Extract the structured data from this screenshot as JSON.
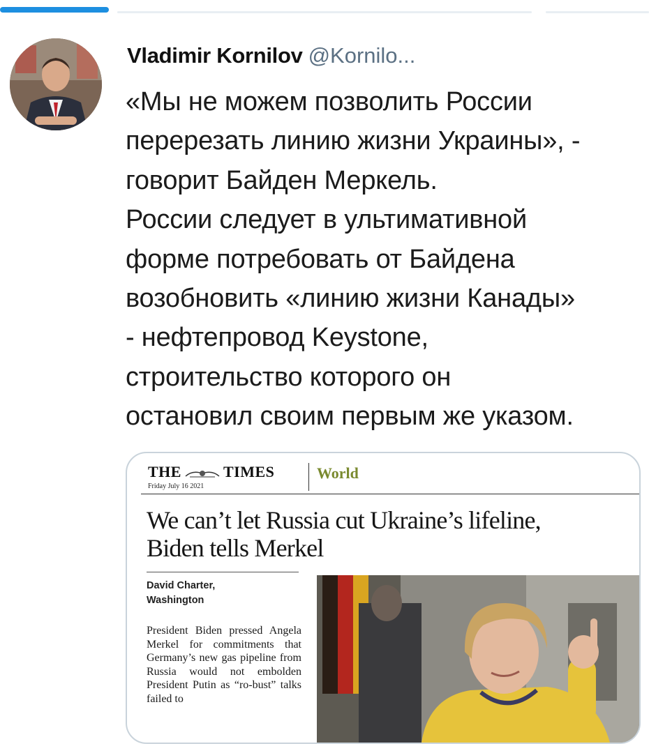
{
  "tweet": {
    "display_name": "Vladimir Kornilov",
    "handle": "@Kornilo...",
    "text_lines": [
      "«Мы не можем позволить России",
      "перерезать линию жизни Украины», -",
      "говорит Байден Меркель.",
      "России следует в ультимативной",
      "форме потребовать от Байдена",
      "возобновить «линию жизни Канады»",
      "- нефтепровод Keystone,",
      "строительство которого он",
      "остановил своим первым же указом."
    ]
  },
  "article": {
    "masthead_left": "THE",
    "masthead_right": "TIMES",
    "date": "Friday July 16 2021",
    "section": "World",
    "headline_lines": [
      "We can’t let Russia cut Ukraine’s lifeline,",
      "Biden tells Merkel"
    ],
    "byline_lines": [
      "David Charter,",
      "Washington"
    ],
    "body": "President Biden pressed Angela Merkel for commitments that Germany’s new gas pipeline from Russia would not embolden President Putin as “ro-bust” talks failed to"
  },
  "colors": {
    "accent_blue": "#1d8fe0",
    "section_green": "#7a8a2f",
    "card_border": "#c9d3db"
  }
}
